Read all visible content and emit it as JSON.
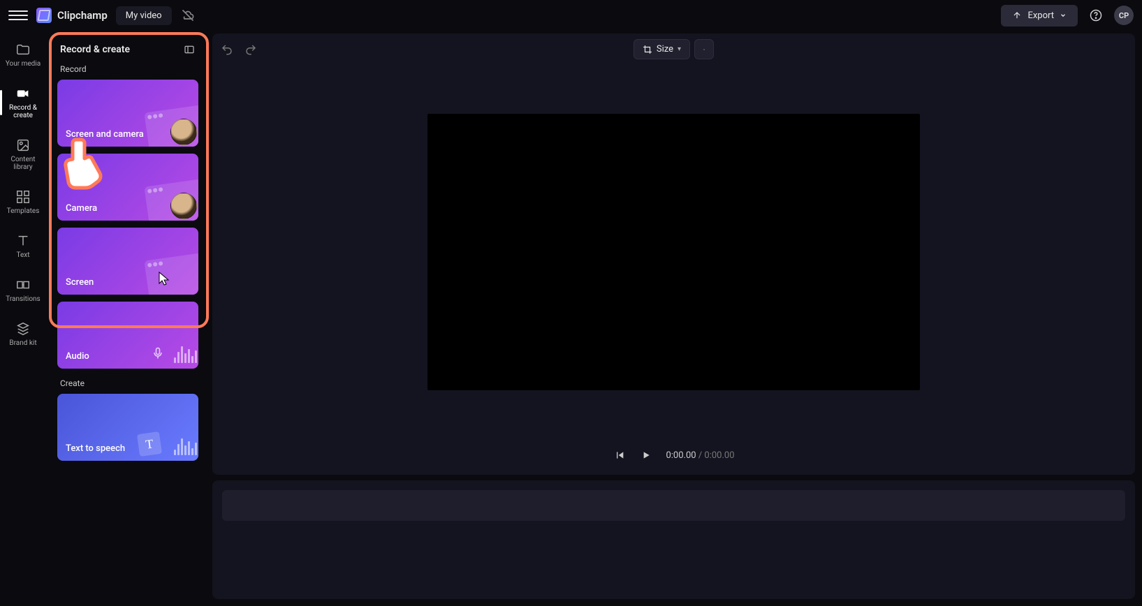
{
  "header": {
    "brand": "Clipchamp",
    "project_name": "My video",
    "export_label": "Export",
    "avatar_initials": "CP"
  },
  "rail": {
    "items": [
      {
        "id": "your-media",
        "label": "Your media"
      },
      {
        "id": "record-create",
        "label": "Record & create"
      },
      {
        "id": "content-library",
        "label": "Content library"
      },
      {
        "id": "templates",
        "label": "Templates"
      },
      {
        "id": "text",
        "label": "Text"
      },
      {
        "id": "transitions",
        "label": "Transitions"
      },
      {
        "id": "brand-kit",
        "label": "Brand kit"
      }
    ],
    "active_id": "record-create"
  },
  "panel": {
    "title": "Record & create",
    "sections": [
      {
        "label": "Record",
        "cards": [
          {
            "id": "screen-and-camera",
            "label": "Screen and camera",
            "style": "purple",
            "art": "window-face"
          },
          {
            "id": "camera",
            "label": "Camera",
            "style": "purple",
            "art": "face"
          },
          {
            "id": "screen",
            "label": "Screen",
            "style": "purple",
            "art": "window-cursor"
          },
          {
            "id": "audio",
            "label": "Audio",
            "style": "purple",
            "art": "mic-wave"
          }
        ]
      },
      {
        "label": "Create",
        "cards": [
          {
            "id": "text-to-speech",
            "label": "Text to speech",
            "style": "blue",
            "art": "tts-wave"
          }
        ]
      }
    ]
  },
  "stage": {
    "size_label": "Size",
    "current_time": "0:00.00",
    "total_time": "0:00.00"
  }
}
